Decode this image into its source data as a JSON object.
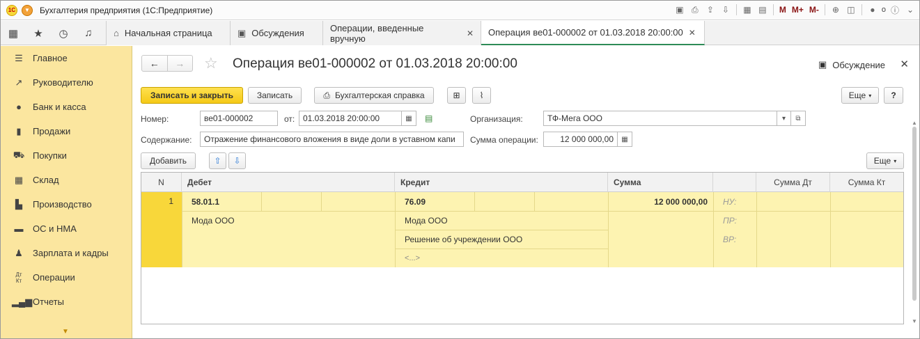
{
  "app": {
    "title": "Бухгалтерия предприятия  (1С:Предприятие)",
    "logo_text": "1C",
    "user_label": "о",
    "m_buttons": [
      "M",
      "M+",
      "M-"
    ]
  },
  "tabs": [
    {
      "label": "Начальная страница",
      "icon": "home-icon"
    },
    {
      "label": "Обсуждения",
      "icon": "chat-icon"
    },
    {
      "label": "Операции, введенные вручную",
      "closable": true
    },
    {
      "label": "Операция ве01-000002 от 01.03.2018 20:00:00",
      "closable": true,
      "active": true
    }
  ],
  "sidebar": {
    "items": [
      {
        "label": "Главное",
        "icon": "menu-lines-icon"
      },
      {
        "label": "Руководителю",
        "icon": "trend-icon"
      },
      {
        "label": "Банк и касса",
        "icon": "coin-icon"
      },
      {
        "label": "Продажи",
        "icon": "bag-icon"
      },
      {
        "label": "Покупки",
        "icon": "cart-icon"
      },
      {
        "label": "Склад",
        "icon": "warehouse-icon"
      },
      {
        "label": "Производство",
        "icon": "factory-icon"
      },
      {
        "label": "ОС и НМА",
        "icon": "truck-icon"
      },
      {
        "label": "Зарплата и кадры",
        "icon": "person-icon"
      },
      {
        "label": "Операции",
        "icon": "dt-kt-icon"
      },
      {
        "label": "Отчеты",
        "icon": "bar-chart-icon"
      }
    ]
  },
  "form": {
    "title": "Операция ве01-000002 от 01.03.2018 20:00:00",
    "discussion_label": "Обсуждение",
    "buttons": {
      "save_close": "Записать и закрыть",
      "save": "Записать",
      "accounting_note": "Бухгалтерская справка",
      "more": "Еще",
      "help": "?",
      "add": "Добавить",
      "more2": "Еще"
    },
    "fields": {
      "number_label": "Номер:",
      "number_value": "ве01-000002",
      "date_label": "от:",
      "date_value": "01.03.2018 20:00:00",
      "org_label": "Организация:",
      "org_value": "ТФ-Мега ООО",
      "content_label": "Содержание:",
      "content_value": "Отражение финансового вложения в виде доли в уставном капи",
      "sum_label": "Сумма операции:",
      "sum_value": "12 000 000,00"
    }
  },
  "table": {
    "columns": [
      "N",
      "Дебет",
      "Кредит",
      "Сумма",
      "",
      "Сумма Дт",
      "Сумма Кт"
    ],
    "rows": [
      {
        "n": "1",
        "debit_account": "58.01.1",
        "debit_subconto": [
          "Мода ООО"
        ],
        "credit_account": "76.09",
        "credit_subconto": [
          "Мода ООО",
          "Решение об учреждении ООО",
          "<...>"
        ],
        "sum": "12 000 000,00",
        "tax_labels": [
          "НУ:",
          "ПР:",
          "ВР:"
        ]
      }
    ]
  }
}
